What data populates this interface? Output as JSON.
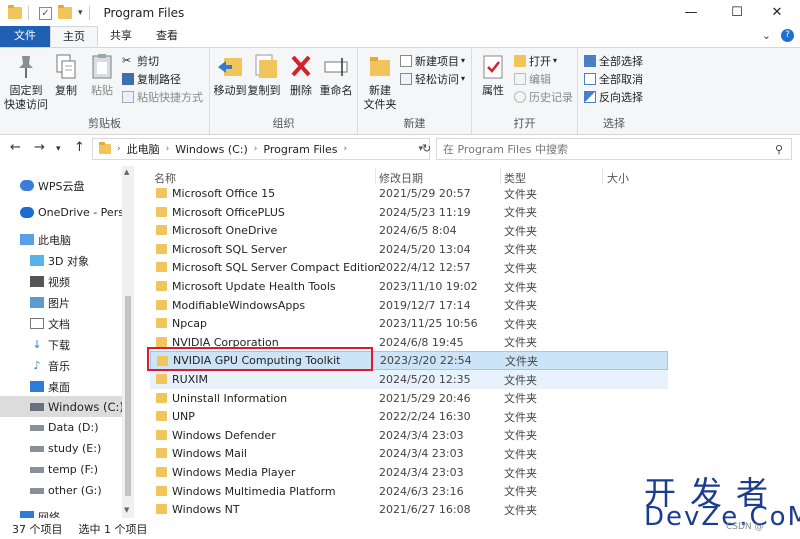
{
  "window": {
    "title": "Program Files",
    "controls": {
      "minimize": "—",
      "maximize": "☐",
      "close": "✕"
    }
  },
  "tabs": [
    "文件",
    "主页",
    "共享",
    "查看"
  ],
  "ribbon": {
    "clipboard": {
      "label": "剪贴板",
      "pin_l1": "固定到",
      "pin_l2": "快速访问",
      "copy": "复制",
      "paste": "粘贴",
      "cut": "剪切",
      "copy_path": "复制路径",
      "paste_shortcut": "粘贴快捷方式"
    },
    "organize": {
      "label": "组织",
      "move_to": "移动到",
      "copy_to": "复制到",
      "delete": "删除",
      "rename": "重命名"
    },
    "new": {
      "label": "新建",
      "new_folder_l1": "新建",
      "new_folder_l2": "文件夹",
      "new_item": "新建项目",
      "easy_access": "轻松访问"
    },
    "open": {
      "label": "打开",
      "properties": "属性",
      "open": "打开",
      "edit": "编辑",
      "history": "历史记录"
    },
    "select": {
      "label": "选择",
      "select_all": "全部选择",
      "select_none": "全部取消",
      "invert": "反向选择"
    }
  },
  "address": {
    "crumbs": [
      "此电脑",
      "Windows (C:)",
      "Program Files"
    ],
    "search_placeholder": "在 Program Files 中搜索"
  },
  "nav": {
    "items": [
      {
        "label": "WPS云盘"
      },
      {
        "label": "OneDrive - Perso"
      },
      {
        "label": "此电脑"
      },
      {
        "label": "3D 对象"
      },
      {
        "label": "视频"
      },
      {
        "label": "图片"
      },
      {
        "label": "文档"
      },
      {
        "label": "下载"
      },
      {
        "label": "音乐"
      },
      {
        "label": "桌面"
      },
      {
        "label": "Windows (C:)"
      },
      {
        "label": "Data (D:)"
      },
      {
        "label": "study (E:)"
      },
      {
        "label": "temp (F:)"
      },
      {
        "label": "other (G:)"
      },
      {
        "label": "网络"
      }
    ]
  },
  "columns": {
    "name": "名称",
    "modified": "修改日期",
    "type": "类型",
    "size": "大小"
  },
  "files": [
    {
      "name": "Microsoft Office 15",
      "date": "2021/5/29 20:57",
      "type": "文件夹"
    },
    {
      "name": "Microsoft OfficePLUS",
      "date": "2024/5/23 11:19",
      "type": "文件夹"
    },
    {
      "name": "Microsoft OneDrive",
      "date": "2024/6/5 8:04",
      "type": "文件夹"
    },
    {
      "name": "Microsoft SQL Server",
      "date": "2024/5/20 13:04",
      "type": "文件夹"
    },
    {
      "name": "Microsoft SQL Server Compact Edition",
      "date": "2022/4/12 12:57",
      "type": "文件夹"
    },
    {
      "name": "Microsoft Update Health Tools",
      "date": "2023/11/10 19:02",
      "type": "文件夹"
    },
    {
      "name": "ModifiableWindowsApps",
      "date": "2019/12/7 17:14",
      "type": "文件夹"
    },
    {
      "name": "Npcap",
      "date": "2023/11/25 10:56",
      "type": "文件夹"
    },
    {
      "name": "NVIDIA Corporation",
      "date": "2024/6/8 19:45",
      "type": "文件夹"
    },
    {
      "name": "NVIDIA GPU Computing Toolkit",
      "date": "2023/3/20 22:54",
      "type": "文件夹"
    },
    {
      "name": "RUXIM",
      "date": "2024/5/20 12:35",
      "type": "文件夹"
    },
    {
      "name": "Uninstall Information",
      "date": "2021/5/29 20:46",
      "type": "文件夹"
    },
    {
      "name": "UNP",
      "date": "2022/2/24 16:30",
      "type": "文件夹"
    },
    {
      "name": "Windows Defender",
      "date": "2024/3/4 23:03",
      "type": "文件夹"
    },
    {
      "name": "Windows Mail",
      "date": "2024/3/4 23:03",
      "type": "文件夹"
    },
    {
      "name": "Windows Media Player",
      "date": "2024/3/4 23:03",
      "type": "文件夹"
    },
    {
      "name": "Windows Multimedia Platform",
      "date": "2024/6/3 23:16",
      "type": "文件夹"
    },
    {
      "name": "Windows NT",
      "date": "2021/6/27 16:08",
      "type": "文件夹"
    }
  ],
  "status": {
    "count": "37 个项目",
    "selected": "选中 1 个项目"
  },
  "watermark": {
    "top": "开发者",
    "bottom": "DevZe.CoM",
    "csdn": "CSDN @"
  }
}
